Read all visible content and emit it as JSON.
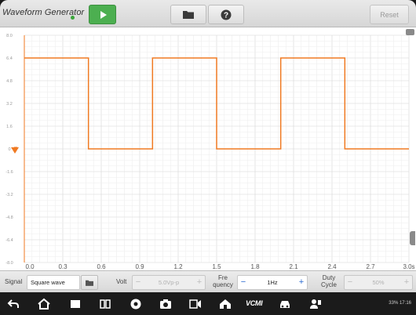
{
  "toolbar": {
    "title": "Waveform Generator",
    "reset_label": "Reset"
  },
  "chart_data": {
    "type": "line",
    "title": "",
    "xlabel": "",
    "ylabel": "",
    "x_ticks": [
      "0.0",
      "0.3",
      "0.6",
      "0.9",
      "1.2",
      "1.5",
      "1.8",
      "2.1",
      "2.4",
      "2.7",
      "3.0s"
    ],
    "y_ticks": [
      "8.0",
      "6.4",
      "4.8",
      "3.2",
      "1.6",
      "0",
      "-1.6",
      "-3.2",
      "-4.8",
      "-6.4",
      "-8.0"
    ],
    "y_ticks_values": [
      8.0,
      6.4,
      4.8,
      3.2,
      1.6,
      0,
      -1.6,
      -3.2,
      -4.8,
      -6.4,
      -8.0
    ],
    "xlim": [
      0,
      3.0
    ],
    "ylim": [
      -8.0,
      8.0
    ],
    "grid": true,
    "series": [
      {
        "color": "#f07a22",
        "x": [
          0.0,
          0.5,
          0.5,
          1.0,
          1.0,
          1.5,
          1.5,
          2.0,
          2.0,
          2.5,
          2.5,
          3.0
        ],
        "values": [
          6.4,
          6.4,
          0,
          0,
          6.4,
          6.4,
          0,
          0,
          6.4,
          6.4,
          0,
          0
        ]
      }
    ]
  },
  "controls": {
    "signal_label": "Signal",
    "signal_value": "Square wave",
    "volt_label": "Volt",
    "volt_value": "5.0Vp-p",
    "freq_label_line1": "Fre",
    "freq_label_line2": "quency",
    "freq_value": "1Hz",
    "duty_label_line1": "Duty",
    "duty_label_line2": "Cycle",
    "duty_value": "50%",
    "minus": "−",
    "plus": "+"
  },
  "navbar": {
    "vcm_label": "VCMI",
    "status": "33% 17:16"
  },
  "colors": {
    "waveform": "#f07a22",
    "grid": "#d9d9d9",
    "play_button": "#4caf50"
  }
}
